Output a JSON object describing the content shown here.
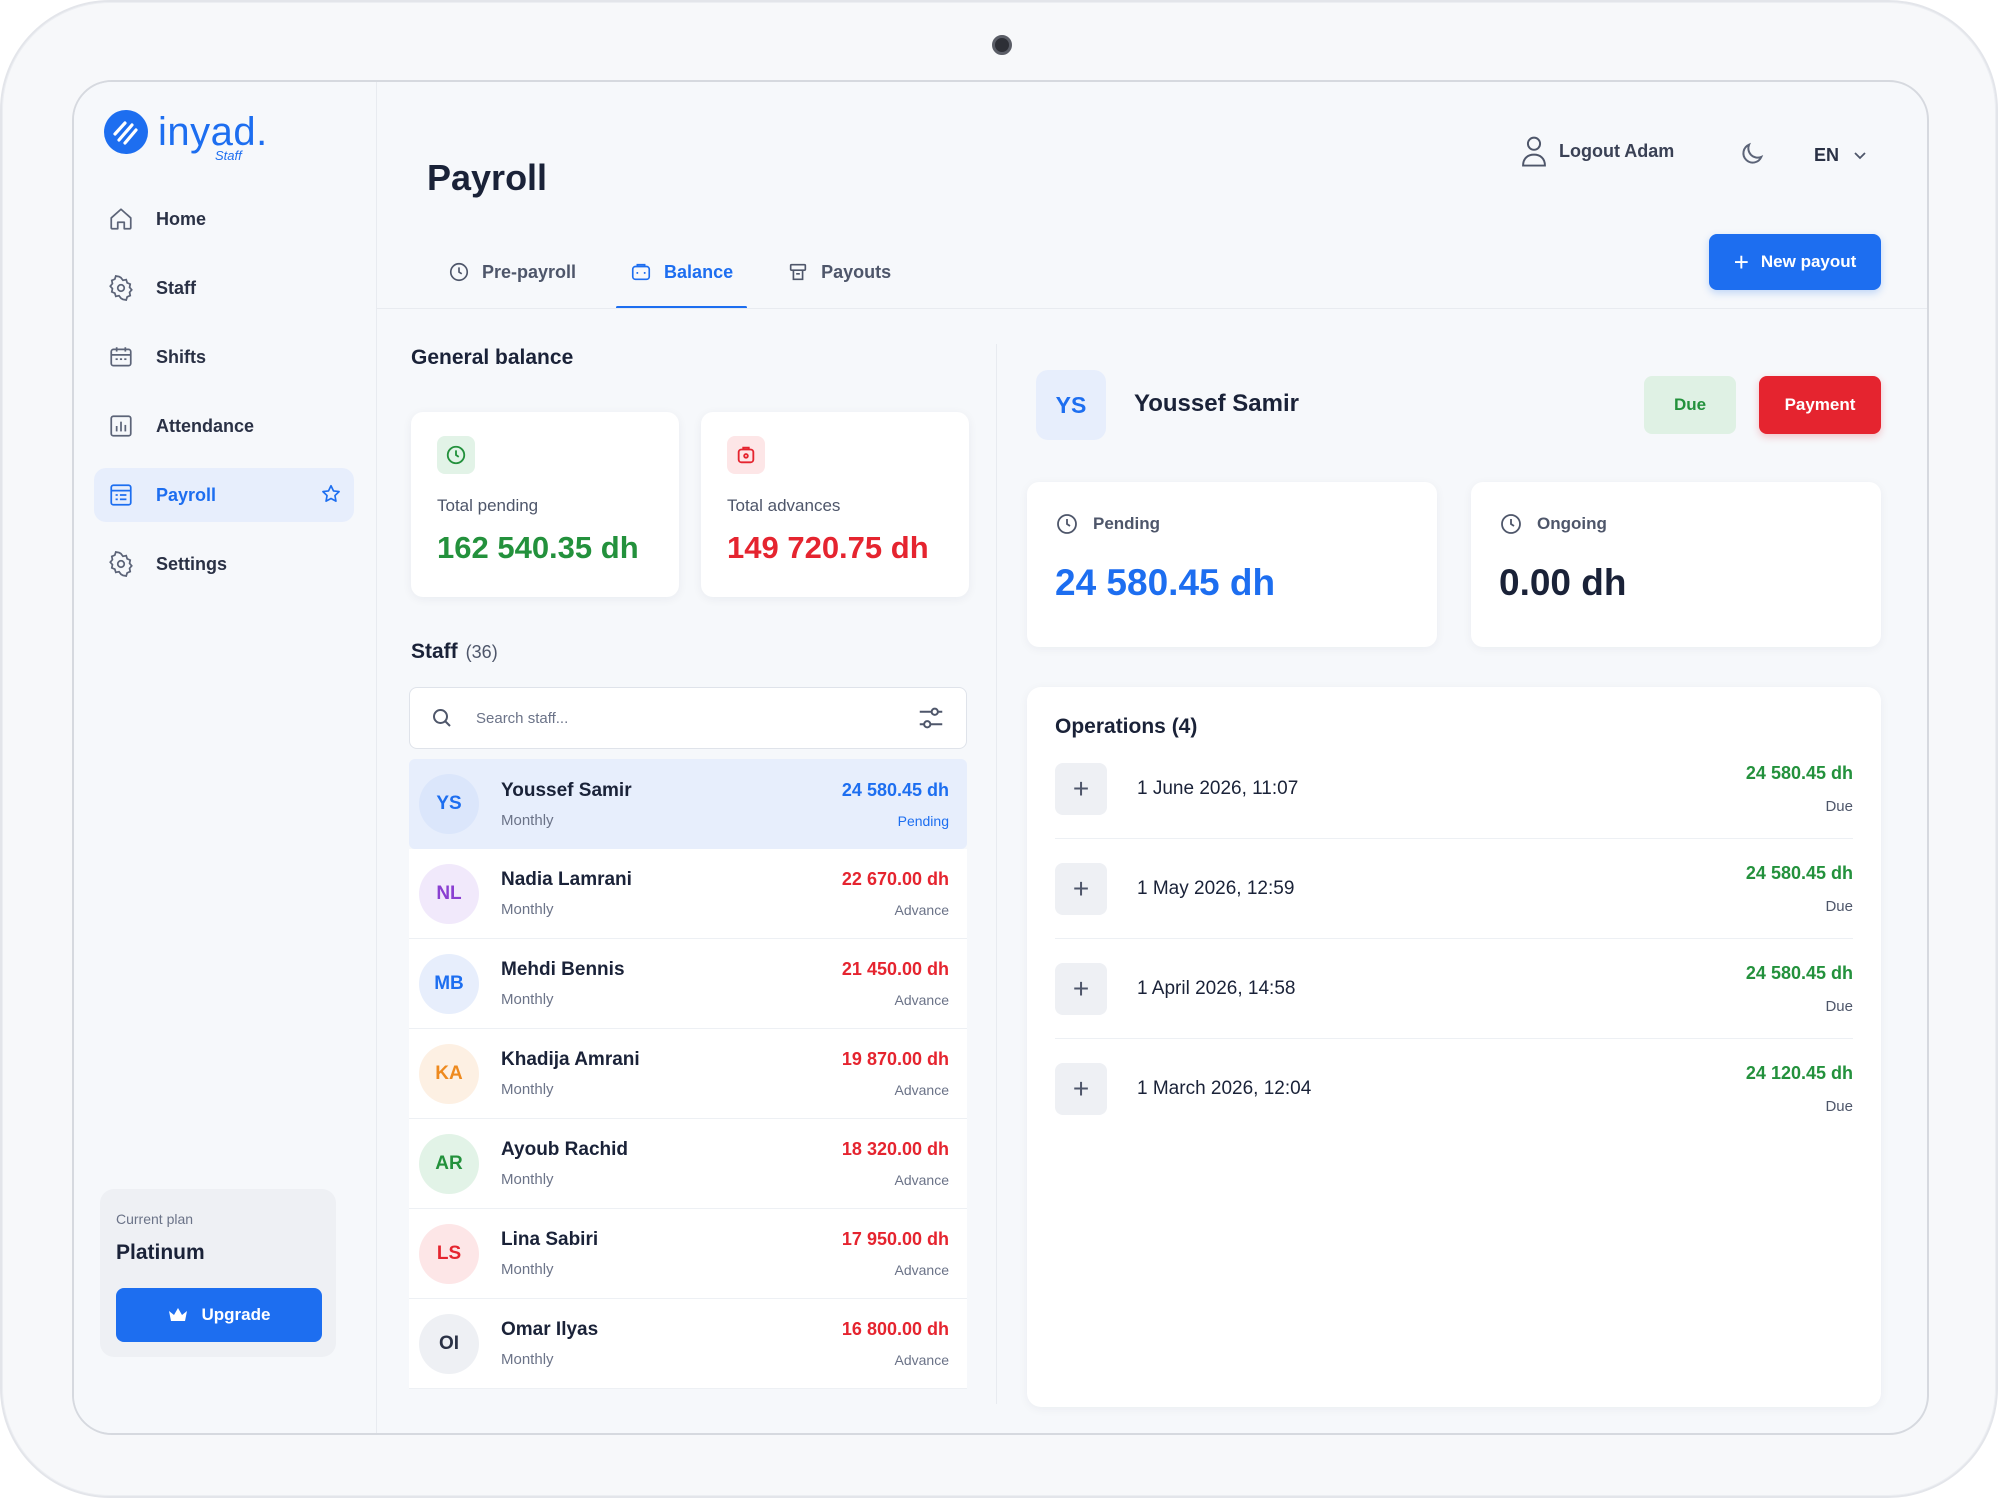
{
  "app": {
    "logo_word": "inyad.",
    "logo_sub": "Staff"
  },
  "colors": {
    "accent": "#1d6ef0",
    "positive": "#23913c",
    "negative": "#e5242f"
  },
  "sidebar": {
    "items": [
      {
        "label": "Home",
        "icon": "home-icon"
      },
      {
        "label": "Staff",
        "icon": "gear-icon"
      },
      {
        "label": "Shifts",
        "icon": "calendar-icon"
      },
      {
        "label": "Attendance",
        "icon": "chart-icon"
      },
      {
        "label": "Payroll",
        "icon": "document-icon",
        "active": true,
        "starred": true
      },
      {
        "label": "Settings",
        "icon": "settings-icon"
      }
    ],
    "plan": {
      "label": "Current plan",
      "name": "Platinum",
      "upgrade_label": "Upgrade"
    }
  },
  "header": {
    "title": "Payroll",
    "user_label": "Logout Adam",
    "language": "EN",
    "new_payout_label": "New payout",
    "tabs": [
      {
        "label": "Pre-payroll",
        "icon": "clock-icon"
      },
      {
        "label": "Balance",
        "icon": "briefcase-icon",
        "active": true
      },
      {
        "label": "Payouts",
        "icon": "printer-icon"
      }
    ]
  },
  "general_balance": {
    "title": "General balance",
    "total_pending": {
      "label": "Total pending",
      "value": "162 540.35 dh"
    },
    "total_advances": {
      "label": "Total advances",
      "value": "149 720.75 dh"
    }
  },
  "staff": {
    "title": "Staff",
    "count": "(36)",
    "search_placeholder": "Search staff...",
    "rows": [
      {
        "initials": "YS",
        "name": "Youssef Samir",
        "type": "Monthly",
        "amount": "24 580.45 dh",
        "status": "Pending",
        "selected": true
      },
      {
        "initials": "NL",
        "name": "Nadia Lamrani",
        "type": "Monthly",
        "amount": "22 670.00 dh",
        "status": "Advance"
      },
      {
        "initials": "MB",
        "name": "Mehdi Bennis",
        "type": "Monthly",
        "amount": "21 450.00 dh",
        "status": "Advance"
      },
      {
        "initials": "KA",
        "name": "Khadija Amrani",
        "type": "Monthly",
        "amount": "19 870.00 dh",
        "status": "Advance"
      },
      {
        "initials": "AR",
        "name": "Ayoub Rachid",
        "type": "Monthly",
        "amount": "18 320.00 dh",
        "status": "Advance"
      },
      {
        "initials": "LS",
        "name": "Lina Sabiri",
        "type": "Monthly",
        "amount": "17 950.00 dh",
        "status": "Advance"
      },
      {
        "initials": "OI",
        "name": "Omar Ilyas",
        "type": "Monthly",
        "amount": "16 800.00 dh",
        "status": "Advance"
      }
    ]
  },
  "detail": {
    "initials": "YS",
    "name": "Youssef Samir",
    "due_label": "Due",
    "payment_label": "Payment",
    "pending": {
      "label": "Pending",
      "value": "24 580.45 dh"
    },
    "ongoing": {
      "label": "Ongoing",
      "value": "0.00 dh"
    },
    "operations": {
      "title": "Operations (4)",
      "rows": [
        {
          "date": "1 June 2026, 11:07",
          "amount": "24 580.45 dh",
          "status": "Due"
        },
        {
          "date": "1 May 2026, 12:59",
          "amount": "24 580.45 dh",
          "status": "Due"
        },
        {
          "date": "1 April 2026, 14:58",
          "amount": "24 580.45 dh",
          "status": "Due"
        },
        {
          "date": "1 March 2026, 12:04",
          "amount": "24 120.45 dh",
          "status": "Due"
        }
      ]
    }
  }
}
